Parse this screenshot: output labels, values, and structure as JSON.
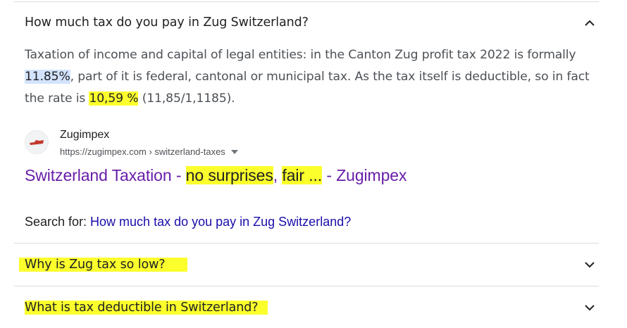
{
  "faq": {
    "open": {
      "question": "How much tax do you pay in Zug Switzerland?",
      "answer": {
        "part1": "Taxation of income and capital of legal entities: in the Canton Zug profit tax 2022 is formally ",
        "highlight_rate": "11.85%",
        "part2": ", part of it is federal, cantonal or municipal tax. As the tax itself is deductible, so in fact the rate is ",
        "highlight_fact": "10,59 %",
        "part3": " (11,85/1,1185)."
      }
    },
    "collapsed": [
      {
        "question": "Why is Zug tax so low?"
      },
      {
        "question": "What is tax deductible in Switzerland?"
      }
    ]
  },
  "source": {
    "site_name": "Zugimpex",
    "url": "https://zugimpex.com › switzerland-taxes",
    "title_parts": [
      "Switzerland Taxation - ",
      "no surprises",
      ", ",
      "fair",
      " ",
      "...",
      " - Zugimpex"
    ]
  },
  "search_for": {
    "label": "Search for: ",
    "query": "How much tax do you pay in Zug Switzerland?"
  },
  "colors": {
    "link_visited": "#681da8",
    "link": "#1a0dab",
    "highlight_yellow": "#fbff2c",
    "highlight_blue": "#d3e3fd"
  },
  "icons": {
    "chevron_up": "chevron-up-icon",
    "chevron_down": "chevron-down-icon",
    "favicon": "zugimpex-logo-icon",
    "menu": "caret-down-icon"
  }
}
